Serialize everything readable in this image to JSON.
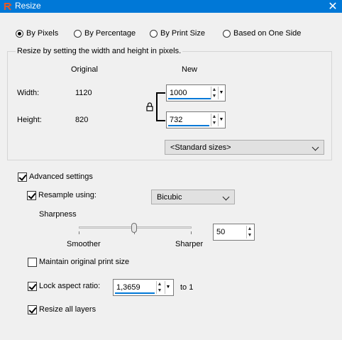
{
  "window": {
    "title": "Resize",
    "close_glyph": "✕"
  },
  "modes": [
    {
      "label": "By Pixels",
      "selected": true
    },
    {
      "label": "By Percentage",
      "selected": false
    },
    {
      "label": "By Print Size",
      "selected": false
    },
    {
      "label": "Based on One Side",
      "selected": false
    }
  ],
  "pixels_group": {
    "legend": "Resize by setting the width and height in pixels.",
    "col_original": "Original",
    "col_new": "New",
    "width_label": "Width:",
    "width_original": "1120",
    "width_new": "1000",
    "height_label": "Height:",
    "height_original": "820",
    "height_new": "732",
    "standard_sizes": "<Standard sizes>",
    "lock_icon": "lock-icon"
  },
  "advanced": {
    "label": "Advanced settings",
    "checked": true,
    "resample_label": "Resample using:",
    "resample_checked": true,
    "resample_method": "Bicubic",
    "sharpness_label": "Sharpness",
    "smoother_label": "Smoother",
    "sharper_label": "Sharper",
    "sharpness_value": "50",
    "maintain_print_label": "Maintain original print size",
    "maintain_print_checked": false,
    "lock_aspect_label": "Lock aspect ratio:",
    "lock_aspect_checked": true,
    "aspect_value": "1,3659",
    "aspect_suffix": "to 1",
    "resize_layers_label": "Resize all layers",
    "resize_layers_checked": true
  },
  "colors": {
    "titlebar": "#0078d7",
    "accent_underline": "#0078d7",
    "dialog_bg": "#f0f0f0"
  }
}
